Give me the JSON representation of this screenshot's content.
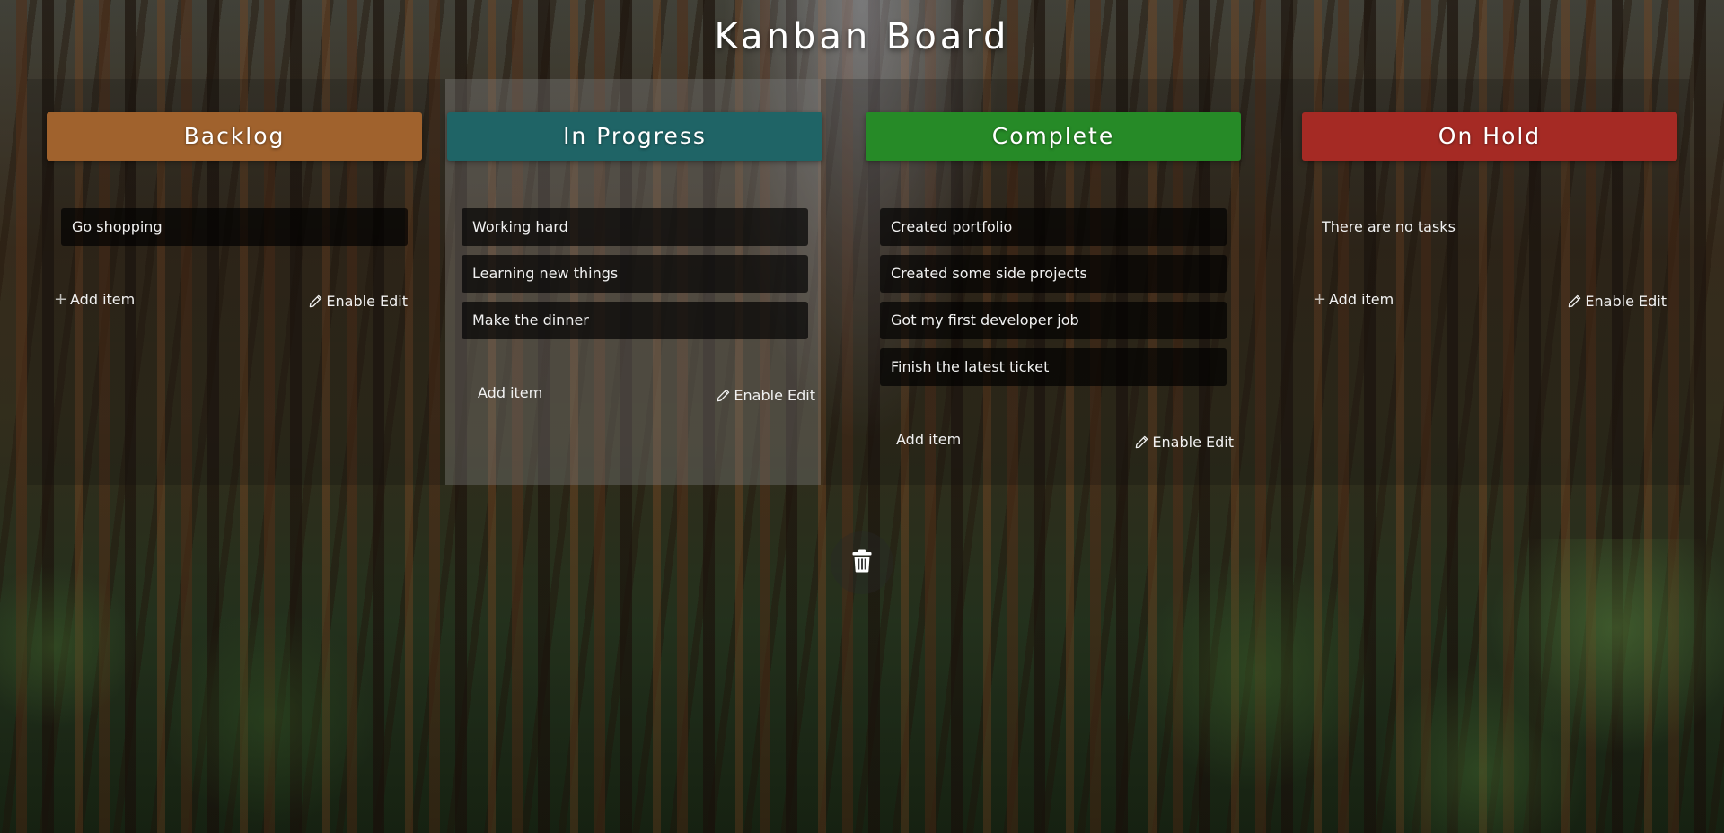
{
  "title": "Kanban Board",
  "columns": [
    {
      "name": "Backlog",
      "color": "#a0622d",
      "items": [
        "Go shopping"
      ],
      "empty_text": "",
      "add_label": "Add item",
      "edit_label": "Enable Edit"
    },
    {
      "name": "In Progress",
      "color": "#1f6466",
      "items": [
        "Working hard",
        "Learning new things",
        "Make the dinner"
      ],
      "empty_text": "",
      "add_label": "Add item",
      "edit_label": "Enable Edit"
    },
    {
      "name": "Complete",
      "color": "#268a27",
      "items": [
        "Created portfolio",
        "Created some side projects",
        "Got my first developer job",
        "Finish the latest ticket"
      ],
      "empty_text": "",
      "add_label": "Add item",
      "edit_label": "Enable Edit"
    },
    {
      "name": "On Hold",
      "color": "#a52a24",
      "items": [],
      "empty_text": "There are no tasks",
      "add_label": "Add item",
      "edit_label": "Enable Edit"
    }
  ],
  "icons": {
    "add": "plus-icon",
    "edit": "pencil-icon",
    "delete": "trash-icon"
  }
}
